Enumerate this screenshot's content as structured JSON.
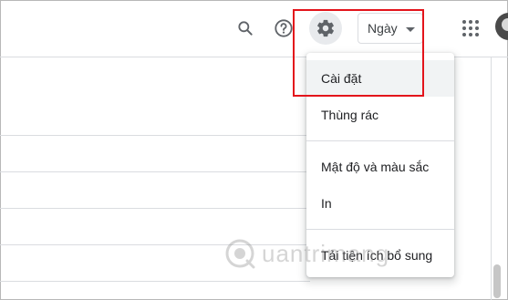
{
  "toolbar": {
    "search_icon": "search-icon",
    "help_icon": "help-icon",
    "settings_icon": "gear-icon",
    "apps_icon": "apps-grid-icon",
    "view_selector": {
      "label": "Ngày"
    }
  },
  "settings_menu": {
    "items": [
      {
        "label": "Cài đặt"
      },
      {
        "label": "Thùng rác"
      },
      {
        "label": "Mật độ và màu sắc"
      },
      {
        "label": "In"
      },
      {
        "label": "Tải tiện ích bổ sung"
      }
    ]
  },
  "watermark": {
    "text": "uantrimang"
  },
  "colors": {
    "highlight": "#e3141b",
    "icon": "#5f6368",
    "divider": "#dadce0",
    "active_bg": "#f1f3f4"
  }
}
